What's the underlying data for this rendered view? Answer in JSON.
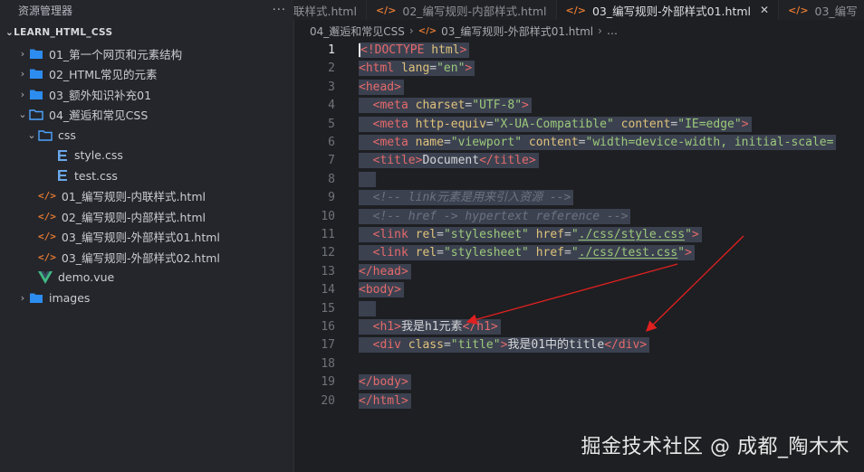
{
  "sidebar": {
    "title": "资源管理器",
    "more": "···",
    "root": "LEARN_HTML_CSS",
    "items": [
      {
        "label": "01_第一个网页和元素结构",
        "type": "folder",
        "chevron": "›"
      },
      {
        "label": "02_HTML常见的元素",
        "type": "folder",
        "chevron": "›"
      },
      {
        "label": "03_额外知识补充01",
        "type": "folder",
        "chevron": "›"
      },
      {
        "label": "04_邂逅和常见CSS",
        "type": "folder-open",
        "chevron": "⌄"
      },
      {
        "label": "css",
        "type": "folder-open",
        "chevron": "⌄"
      },
      {
        "label": "style.css",
        "type": "css"
      },
      {
        "label": "test.css",
        "type": "css"
      },
      {
        "label": "01_编写规则-内联样式.html",
        "type": "html"
      },
      {
        "label": "02_编写规则-内部样式.html",
        "type": "html"
      },
      {
        "label": "03_编写规则-外部样式01.html",
        "type": "html"
      },
      {
        "label": "03_编写规则-外部样式02.html",
        "type": "html"
      },
      {
        "label": "demo.vue",
        "type": "vue"
      },
      {
        "label": "images",
        "type": "folder",
        "chevron": "›"
      }
    ]
  },
  "tabs": [
    {
      "label": "联样式.html",
      "icon": "",
      "active": false
    },
    {
      "label": "02_编写规则-内部样式.html",
      "icon": "</>",
      "active": false
    },
    {
      "label": "03_编写规则-外部样式01.html",
      "icon": "</>",
      "active": true,
      "close": "✕"
    },
    {
      "label": "03_编写",
      "icon": "</>",
      "active": false
    }
  ],
  "breadcrumb": {
    "folder": "04_邂逅和常见CSS",
    "sep": "›",
    "icon": "</>",
    "file": "03_编写规则-外部样式01.html",
    "sep2": "›",
    "tail": "…"
  },
  "editor": {
    "line_numbers": [
      "1",
      "2",
      "3",
      "4",
      "5",
      "6",
      "7",
      "8",
      "9",
      "10",
      "11",
      "12",
      "13",
      "14",
      "15",
      "16",
      "17",
      "18",
      "19",
      "20"
    ],
    "lines": [
      [
        {
          "c": "tg",
          "t": "<"
        },
        {
          "c": "tg",
          "t": "!DOCTYPE"
        },
        {
          "c": "pn",
          "t": " "
        },
        {
          "c": "at",
          "t": "html"
        },
        {
          "c": "tg",
          "t": ">"
        }
      ],
      [
        {
          "c": "tg",
          "t": "<html"
        },
        {
          "c": "pn",
          "t": " "
        },
        {
          "c": "at",
          "t": "lang"
        },
        {
          "c": "pn",
          "t": "="
        },
        {
          "c": "st",
          "t": "\"en\""
        },
        {
          "c": "tg",
          "t": ">"
        }
      ],
      [
        {
          "c": "tg",
          "t": "<head>"
        }
      ],
      [
        {
          "c": "pn",
          "t": "  "
        },
        {
          "c": "tg",
          "t": "<meta"
        },
        {
          "c": "pn",
          "t": " "
        },
        {
          "c": "at",
          "t": "charset"
        },
        {
          "c": "pn",
          "t": "="
        },
        {
          "c": "st",
          "t": "\"UTF-8\""
        },
        {
          "c": "tg",
          "t": ">"
        }
      ],
      [
        {
          "c": "pn",
          "t": "  "
        },
        {
          "c": "tg",
          "t": "<meta"
        },
        {
          "c": "pn",
          "t": " "
        },
        {
          "c": "at",
          "t": "http-equiv"
        },
        {
          "c": "pn",
          "t": "="
        },
        {
          "c": "st",
          "t": "\"X-UA-Compatible\""
        },
        {
          "c": "pn",
          "t": " "
        },
        {
          "c": "at",
          "t": "content"
        },
        {
          "c": "pn",
          "t": "="
        },
        {
          "c": "st",
          "t": "\"IE=edge\""
        },
        {
          "c": "tg",
          "t": ">"
        }
      ],
      [
        {
          "c": "pn",
          "t": "  "
        },
        {
          "c": "tg",
          "t": "<meta"
        },
        {
          "c": "pn",
          "t": " "
        },
        {
          "c": "at",
          "t": "name"
        },
        {
          "c": "pn",
          "t": "="
        },
        {
          "c": "st",
          "t": "\"viewport\""
        },
        {
          "c": "pn",
          "t": " "
        },
        {
          "c": "at",
          "t": "content"
        },
        {
          "c": "pn",
          "t": "="
        },
        {
          "c": "st",
          "t": "\"width=device-width, initial-scale="
        }
      ],
      [
        {
          "c": "pn",
          "t": "  "
        },
        {
          "c": "tg",
          "t": "<title>"
        },
        {
          "c": "tx",
          "t": "Document"
        },
        {
          "c": "tg",
          "t": "</title>"
        }
      ],
      [
        {
          "c": "pn",
          "t": "  "
        }
      ],
      [
        {
          "c": "pn",
          "t": "  "
        },
        {
          "c": "cm",
          "t": "<!-- link元素是用来引入资源 -->"
        }
      ],
      [
        {
          "c": "pn",
          "t": "  "
        },
        {
          "c": "cm",
          "t": "<!-- href -> hypertext reference -->"
        }
      ],
      [
        {
          "c": "pn",
          "t": "  "
        },
        {
          "c": "tg",
          "t": "<link"
        },
        {
          "c": "pn",
          "t": " "
        },
        {
          "c": "at",
          "t": "rel"
        },
        {
          "c": "pn",
          "t": "="
        },
        {
          "c": "st",
          "t": "\"stylesheet\""
        },
        {
          "c": "pn",
          "t": " "
        },
        {
          "c": "at",
          "t": "href"
        },
        {
          "c": "pn",
          "t": "="
        },
        {
          "c": "st",
          "t": "\""
        },
        {
          "c": "st ul",
          "t": "./css/style.css"
        },
        {
          "c": "st",
          "t": "\""
        },
        {
          "c": "tg",
          "t": ">"
        }
      ],
      [
        {
          "c": "pn",
          "t": "  "
        },
        {
          "c": "tg",
          "t": "<link"
        },
        {
          "c": "pn",
          "t": " "
        },
        {
          "c": "at",
          "t": "rel"
        },
        {
          "c": "pn",
          "t": "="
        },
        {
          "c": "st",
          "t": "\"stylesheet\""
        },
        {
          "c": "pn",
          "t": " "
        },
        {
          "c": "at",
          "t": "href"
        },
        {
          "c": "pn",
          "t": "="
        },
        {
          "c": "st",
          "t": "\""
        },
        {
          "c": "st ul",
          "t": "./css/test.css"
        },
        {
          "c": "st",
          "t": "\""
        },
        {
          "c": "tg",
          "t": ">"
        }
      ],
      [
        {
          "c": "tg",
          "t": "</head>"
        }
      ],
      [
        {
          "c": "tg",
          "t": "<body>"
        }
      ],
      [
        {
          "c": "pn",
          "t": "  "
        }
      ],
      [
        {
          "c": "pn",
          "t": "  "
        },
        {
          "c": "tg",
          "t": "<h1>"
        },
        {
          "c": "tx",
          "t": "我是h1元素"
        },
        {
          "c": "tg",
          "t": "</h1>"
        }
      ],
      [
        {
          "c": "pn",
          "t": "  "
        },
        {
          "c": "tg",
          "t": "<div"
        },
        {
          "c": "pn",
          "t": " "
        },
        {
          "c": "at",
          "t": "class"
        },
        {
          "c": "pn",
          "t": "="
        },
        {
          "c": "st",
          "t": "\"title\""
        },
        {
          "c": "tg",
          "t": ">"
        },
        {
          "c": "tx",
          "t": "我是01中的title"
        },
        {
          "c": "tg",
          "t": "</div>"
        }
      ],
      [],
      [
        {
          "c": "tg",
          "t": "</body>"
        }
      ],
      [
        {
          "c": "tg",
          "t": "</html>"
        }
      ]
    ]
  },
  "watermark": "掘金技术社区 @ 成都_陶木木",
  "colors": {
    "tag": "#e46a6a",
    "attr": "#dec27a",
    "string": "#9bc97a",
    "comment": "#6b7280",
    "selection": "#3c4150",
    "annotation_arrow": "#e02020"
  }
}
